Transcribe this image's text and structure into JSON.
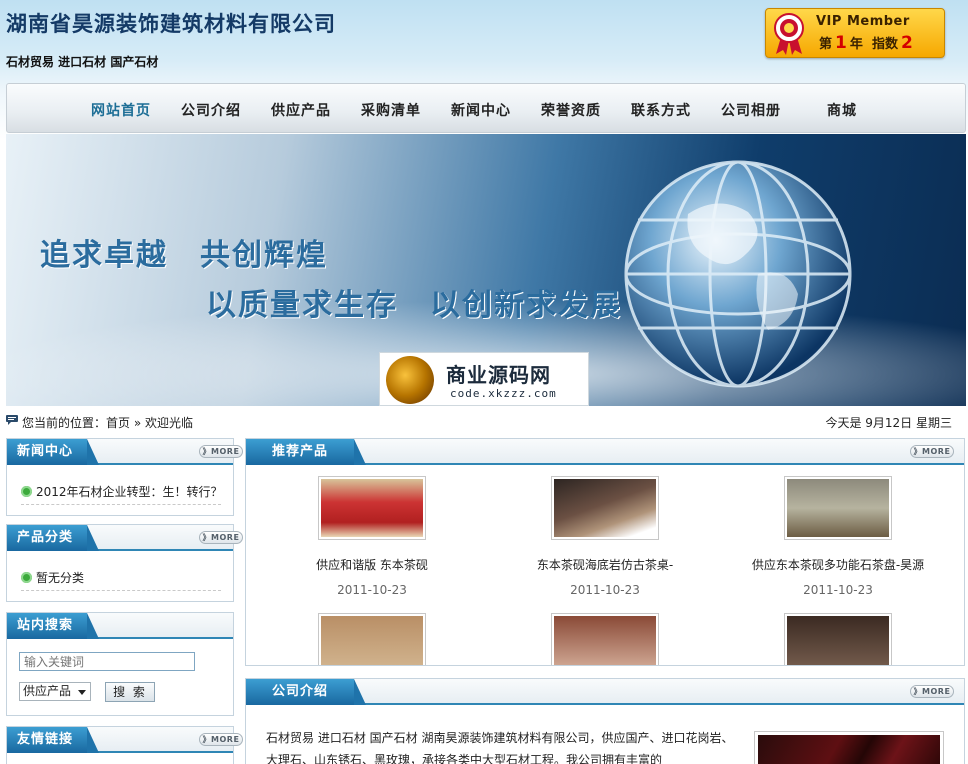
{
  "header": {
    "company_name": "湖南省昊源装饰建筑材料有限公司",
    "tagline": "石材贸易 进口石材 国产石材",
    "vip": {
      "title": "VIP Member",
      "prefix": "第",
      "years": "1",
      "year_unit": "年",
      "index_label": "指数",
      "index": "2"
    }
  },
  "nav": {
    "items": [
      "网站首页",
      "公司介绍",
      "供应产品",
      "采购清单",
      "新闻中心",
      "荣誉资质",
      "联系方式",
      "公司相册",
      "商城"
    ],
    "active": 0
  },
  "banner": {
    "slogan_line1": "追求卓越　共创辉煌",
    "slogan_line2": "以质量求生存　以创新求发展",
    "watermark_title": "商业源码网",
    "watermark_url": "code.xkzzz.com"
  },
  "location": {
    "label": "您当前的位置：",
    "home": "首页",
    "separator": "»",
    "current": "欢迎光临",
    "today": "今天是  9月12日 星期三"
  },
  "sidebar": {
    "news": {
      "title": "新闻中心",
      "more": "》MORE",
      "items": [
        "2012年石材企业转型：生！转行？"
      ]
    },
    "categories": {
      "title": "产品分类",
      "more": "》MORE",
      "items": [
        "暂无分类"
      ]
    },
    "search": {
      "title": "站内搜索",
      "placeholder": "输入关键词",
      "select_value": "供应产品",
      "button": "搜 索"
    },
    "links": {
      "title": "友情链接",
      "more": "》MORE"
    }
  },
  "products": {
    "title": "推荐产品",
    "more": "》MORE",
    "items": [
      {
        "name": "供应和谐版 东本茶砚",
        "date": "2011-10-23"
      },
      {
        "name": "东本茶砚海底岩仿古茶桌-",
        "date": "2011-10-23"
      },
      {
        "name": "供应东本茶砚多功能石茶盘-昊源",
        "date": "2011-10-23"
      }
    ]
  },
  "about": {
    "title": "公司介绍",
    "more": "》MORE",
    "text": "石材贸易 进口石材 国产石材 湖南昊源装饰建筑材料有限公司，供应国产、进口花岗岩、大理石、山东锈石、黑玫瑰，承接各类中大型石材工程。我公司拥有丰富的"
  },
  "colors": {
    "accent": "#1968a0",
    "nav_active": "#1d6e96",
    "vip_gold": "#f6a800",
    "year_red": "#d40000"
  }
}
